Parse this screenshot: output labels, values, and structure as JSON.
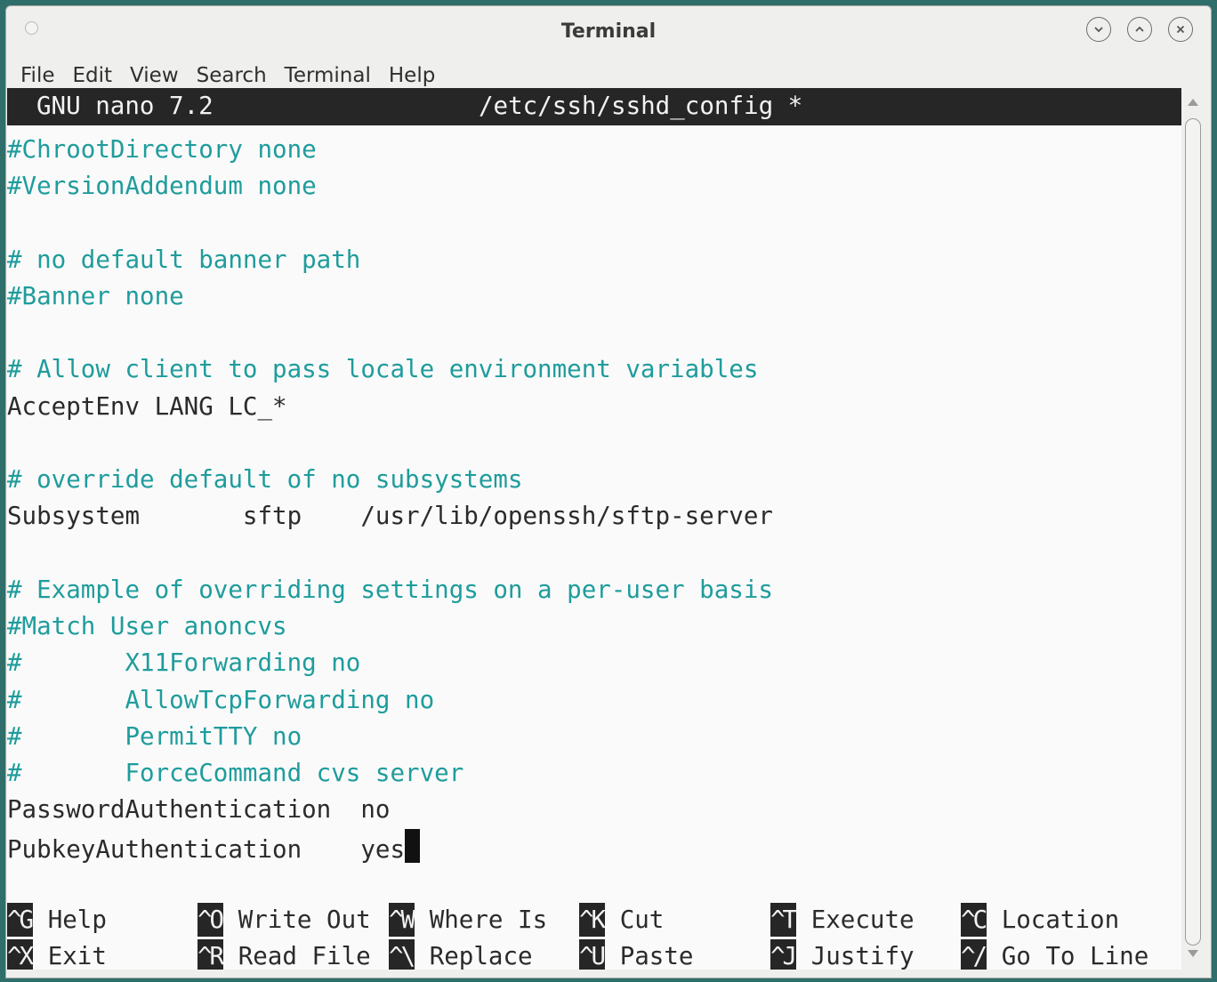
{
  "window": {
    "title": "Terminal"
  },
  "menu": [
    "File",
    "Edit",
    "View",
    "Search",
    "Terminal",
    "Help"
  ],
  "nano": {
    "app": "GNU nano 7.2",
    "file": "/etc/ssh/sshd_config *"
  },
  "lines": [
    "#ChrootDirectory none",
    "#VersionAddendum none",
    "",
    "# no default banner path",
    "#Banner none",
    "",
    "# Allow client to pass locale environment variables",
    "AcceptEnv LANG LC_*",
    "",
    "# override default of no subsystems",
    "Subsystem       sftp    /usr/lib/openssh/sftp-server",
    "",
    "# Example of overriding settings on a per-user basis",
    "#Match User anoncvs",
    "#       X11Forwarding no",
    "#       AllowTcpForwarding no",
    "#       PermitTTY no",
    "#       ForceCommand cvs server",
    "PasswordAuthentication  no",
    "PubkeyAuthentication    yes"
  ],
  "shortcuts_row1": [
    {
      "key": "^G",
      "label": "Help"
    },
    {
      "key": "^O",
      "label": "Write Out"
    },
    {
      "key": "^W",
      "label": "Where Is"
    },
    {
      "key": "^K",
      "label": "Cut"
    },
    {
      "key": "^T",
      "label": "Execute"
    },
    {
      "key": "^C",
      "label": "Location"
    }
  ],
  "shortcuts_row2": [
    {
      "key": "^X",
      "label": "Exit"
    },
    {
      "key": "^R",
      "label": "Read File"
    },
    {
      "key": "^\\",
      "label": "Replace"
    },
    {
      "key": "^U",
      "label": "Paste"
    },
    {
      "key": "^J",
      "label": "Justify"
    },
    {
      "key": "^/",
      "label": "Go To Line"
    }
  ],
  "colors": {
    "comment": "#1f9c9c",
    "text": "#2b2b2b",
    "bar": "#262626"
  }
}
